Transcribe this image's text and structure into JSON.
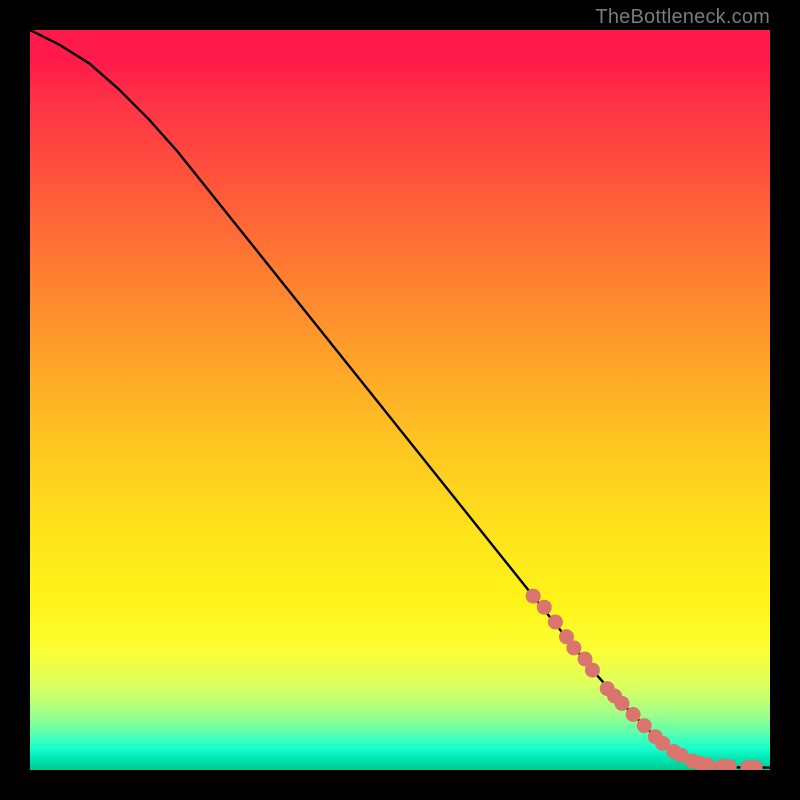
{
  "watermark": "TheBottleneck.com",
  "colors": {
    "background": "#000000",
    "curve": "#000000",
    "marker_fill": "#d9756d",
    "marker_stroke": "#c15a52"
  },
  "chart_data": {
    "type": "line",
    "title": "",
    "xlabel": "",
    "ylabel": "",
    "xlim": [
      0,
      100
    ],
    "ylim": [
      0,
      100
    ],
    "show_axes": false,
    "show_grid": false,
    "curve": {
      "description": "Bottleneck curve: high at left, descends nearly linearly, flattens to ~0 on the right.",
      "x": [
        0,
        4,
        8,
        12,
        16,
        20,
        24,
        28,
        32,
        36,
        40,
        44,
        48,
        52,
        56,
        60,
        64,
        68,
        72,
        76,
        80,
        84,
        86,
        88,
        90,
        92,
        94,
        96,
        98,
        100
      ],
      "y": [
        100,
        98,
        95.5,
        92,
        88,
        83.5,
        78.5,
        73.5,
        68.5,
        63.5,
        58.5,
        53.5,
        48.5,
        43.5,
        38.5,
        33.5,
        28.5,
        23.5,
        18.5,
        13.5,
        9,
        5,
        3.3,
        2,
        1.1,
        0.6,
        0.4,
        0.35,
        0.33,
        0.33
      ]
    },
    "markers": {
      "description": "Highlighted data points (salmon dots) clustered on the lower-right tail of the curve.",
      "points": [
        {
          "x": 68,
          "y": 23.5
        },
        {
          "x": 69.5,
          "y": 22
        },
        {
          "x": 71,
          "y": 20
        },
        {
          "x": 72.5,
          "y": 18
        },
        {
          "x": 73.5,
          "y": 16.5
        },
        {
          "x": 75,
          "y": 15
        },
        {
          "x": 76,
          "y": 13.5
        },
        {
          "x": 78,
          "y": 11
        },
        {
          "x": 79,
          "y": 10
        },
        {
          "x": 80,
          "y": 9
        },
        {
          "x": 81.5,
          "y": 7.5
        },
        {
          "x": 83,
          "y": 6
        },
        {
          "x": 84.5,
          "y": 4.5
        },
        {
          "x": 85.5,
          "y": 3.6
        },
        {
          "x": 87,
          "y": 2.5
        },
        {
          "x": 88,
          "y": 2
        },
        {
          "x": 89.5,
          "y": 1.2
        },
        {
          "x": 90.5,
          "y": 0.9
        },
        {
          "x": 91.5,
          "y": 0.7
        },
        {
          "x": 93.5,
          "y": 0.5
        },
        {
          "x": 94.5,
          "y": 0.45
        },
        {
          "x": 97,
          "y": 0.35
        },
        {
          "x": 98,
          "y": 0.35
        }
      ]
    }
  }
}
